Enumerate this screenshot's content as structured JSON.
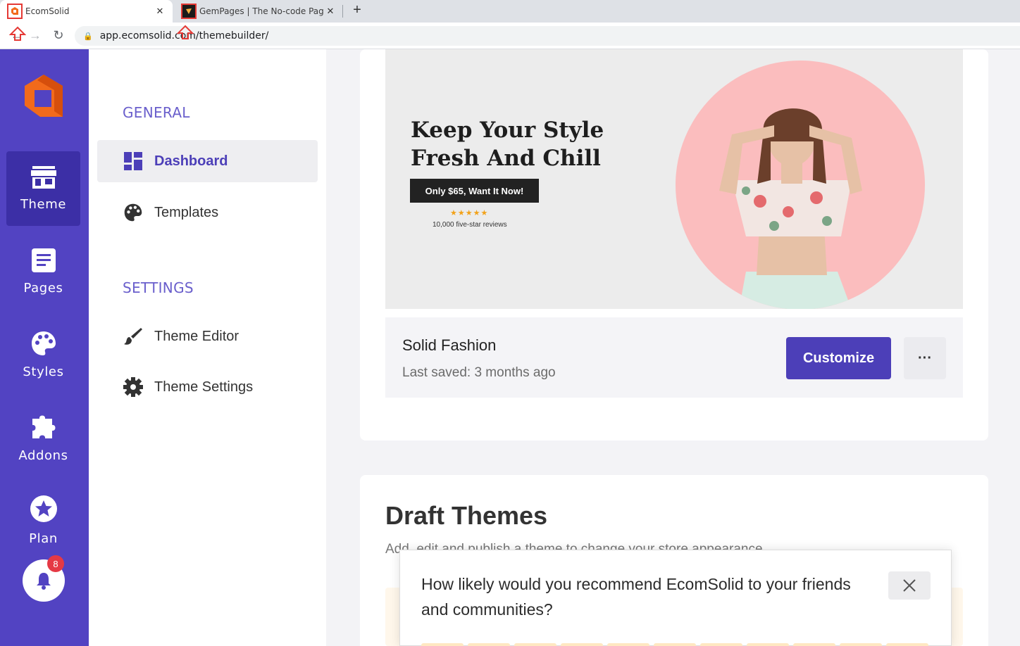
{
  "browser": {
    "tabs": [
      {
        "title": "EcomSolid",
        "close": "✕"
      },
      {
        "title": "GemPages | The No-code Page B",
        "close": "✕"
      }
    ],
    "new_tab": "+",
    "url": "app.ecomsolid.com/themebuilder/"
  },
  "rail": {
    "items": [
      {
        "label": "Theme",
        "icon": "store-icon",
        "active": true
      },
      {
        "label": "Pages",
        "icon": "page-icon"
      },
      {
        "label": "Styles",
        "icon": "palette-icon"
      },
      {
        "label": "Addons",
        "icon": "puzzle-icon"
      },
      {
        "label": "Plan",
        "icon": "star-icon"
      }
    ],
    "notifications": "8"
  },
  "subnav": {
    "general_label": "GENERAL",
    "settings_label": "SETTINGS",
    "items": [
      {
        "label": "Dashboard",
        "icon": "dashboard-icon",
        "active": true
      },
      {
        "label": "Templates",
        "icon": "palette-icon"
      },
      {
        "label": "Theme Editor",
        "icon": "brush-icon"
      },
      {
        "label": "Theme Settings",
        "icon": "gear-icon"
      }
    ]
  },
  "current_theme": {
    "banner": {
      "headline_1": "Keep Your Style",
      "headline_2": "Fresh And Chill",
      "cta": "Only $65, Want It Now!",
      "stars": "★★★★★",
      "reviews": "10,000 five-star reviews"
    },
    "name": "Solid Fashion",
    "last_saved": "Last saved: 3 months ago",
    "customize_label": "Customize",
    "more_label": "···"
  },
  "draft_themes": {
    "title": "Draft Themes",
    "subtitle": "Add, edit and publish a theme to change your store appearance"
  },
  "survey": {
    "question": "How likely would you recommend EcomSolid to your friends and communities?"
  },
  "colors": {
    "brand": "#5243c2",
    "accent": "#4c3fb8",
    "logo_orange": "#f26a1b"
  }
}
